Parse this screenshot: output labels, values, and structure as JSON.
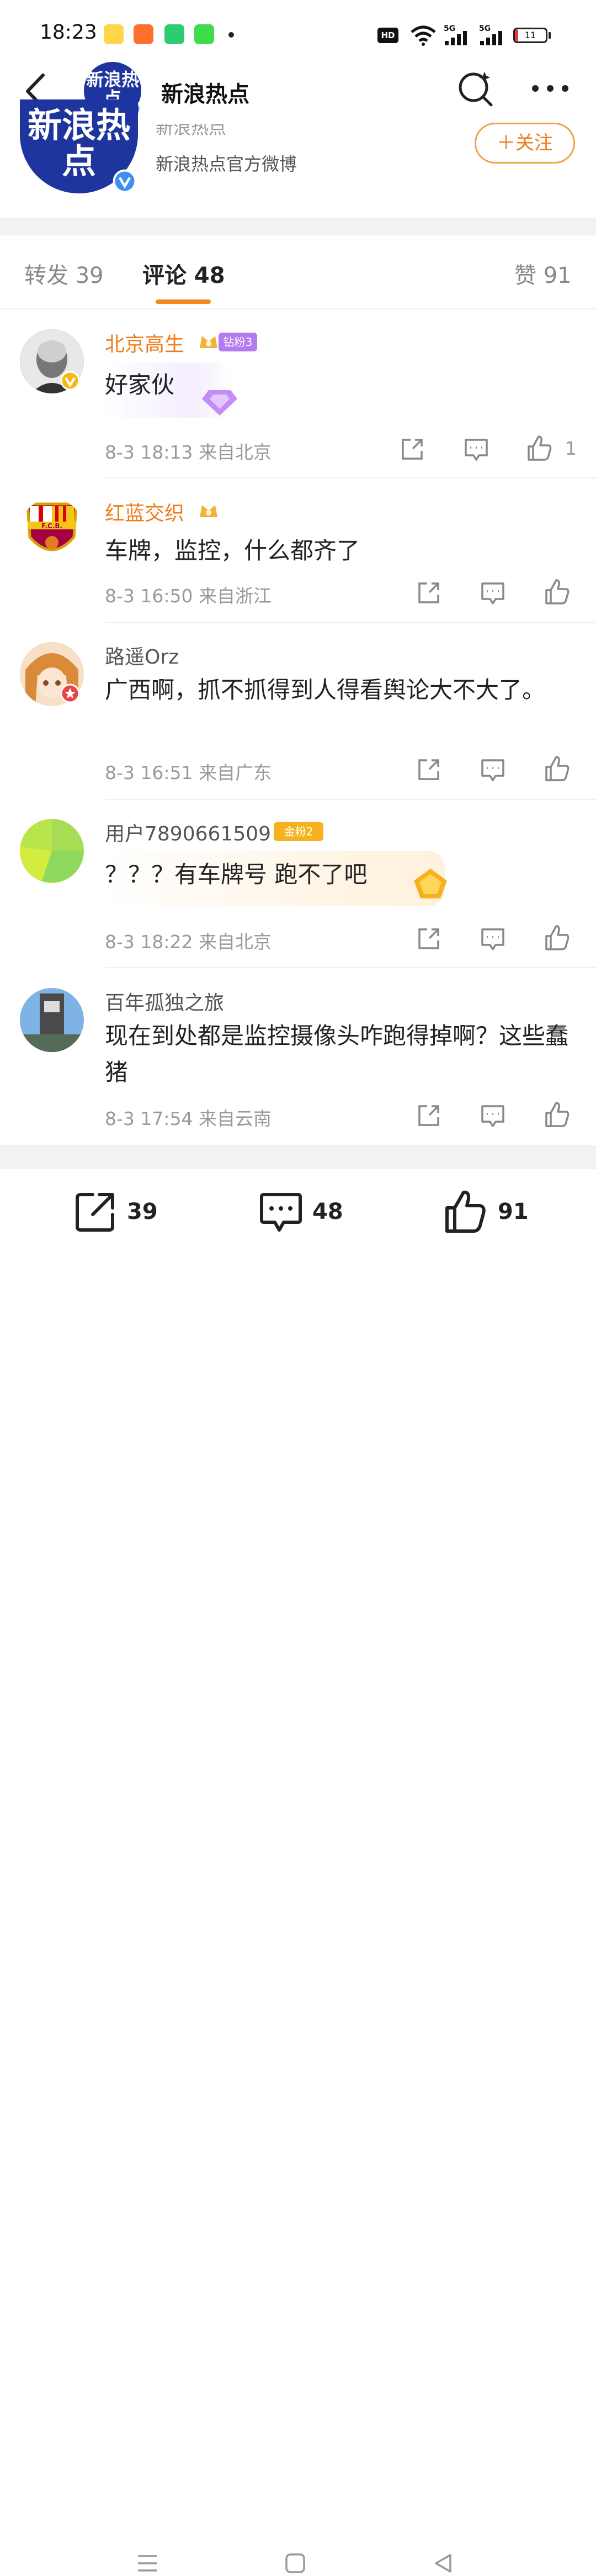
{
  "status_bar": {
    "time": "18:23",
    "hd": "HD",
    "signal_1": "5G",
    "signal_2": "5G",
    "battery": "11",
    "battery_level": 0.11
  },
  "header": {
    "title": "新浪热点",
    "avatar_text": "新浪热点"
  },
  "profile": {
    "name": "新浪热点",
    "description": "新浪热点官方微博",
    "follow_label": "＋关注"
  },
  "tabs": [
    {
      "label": "转发 39"
    },
    {
      "label": "评论 48"
    },
    {
      "label": "赞 91"
    }
  ],
  "comments": [
    {
      "user": "北京高生",
      "name_color": "#ee7d1c",
      "badge": "钻粉3",
      "text": "好家伙",
      "meta": "8-3 18:13  来自北京",
      "likes": "1"
    },
    {
      "user": "红蓝交织",
      "name_color": "#ee7d1c",
      "badge": "",
      "text": "车牌，监控，什么都齐了",
      "meta": "8-3 16:50  来自浙江",
      "likes": ""
    },
    {
      "user": "路遥Orz",
      "name_color": "#555555",
      "badge": "",
      "text": "广西啊，抓不抓得到人得看舆论大不大了。",
      "meta": "8-3 16:51  来自广东",
      "likes": ""
    },
    {
      "user": "用户7890661509",
      "name_color": "#555555",
      "badge": "金粉2",
      "text": "？？？有车牌号 跑不了吧",
      "meta": "8-3 18:22  来自北京",
      "likes": ""
    },
    {
      "user": "百年孤独之旅",
      "name_color": "#555555",
      "badge": "",
      "text": "现在到处都是监控摄像头咋跑得掉啊？这些蠢猪",
      "meta": "8-3 17:54  来自云南",
      "likes": ""
    }
  ],
  "bottom_bar": {
    "repost_count": "39",
    "comment_count": "48",
    "like_count": "91"
  },
  "colors": {
    "accent": "#ee7d1c",
    "brand_blue": "#1e35a0",
    "verified": "#f5c518"
  }
}
